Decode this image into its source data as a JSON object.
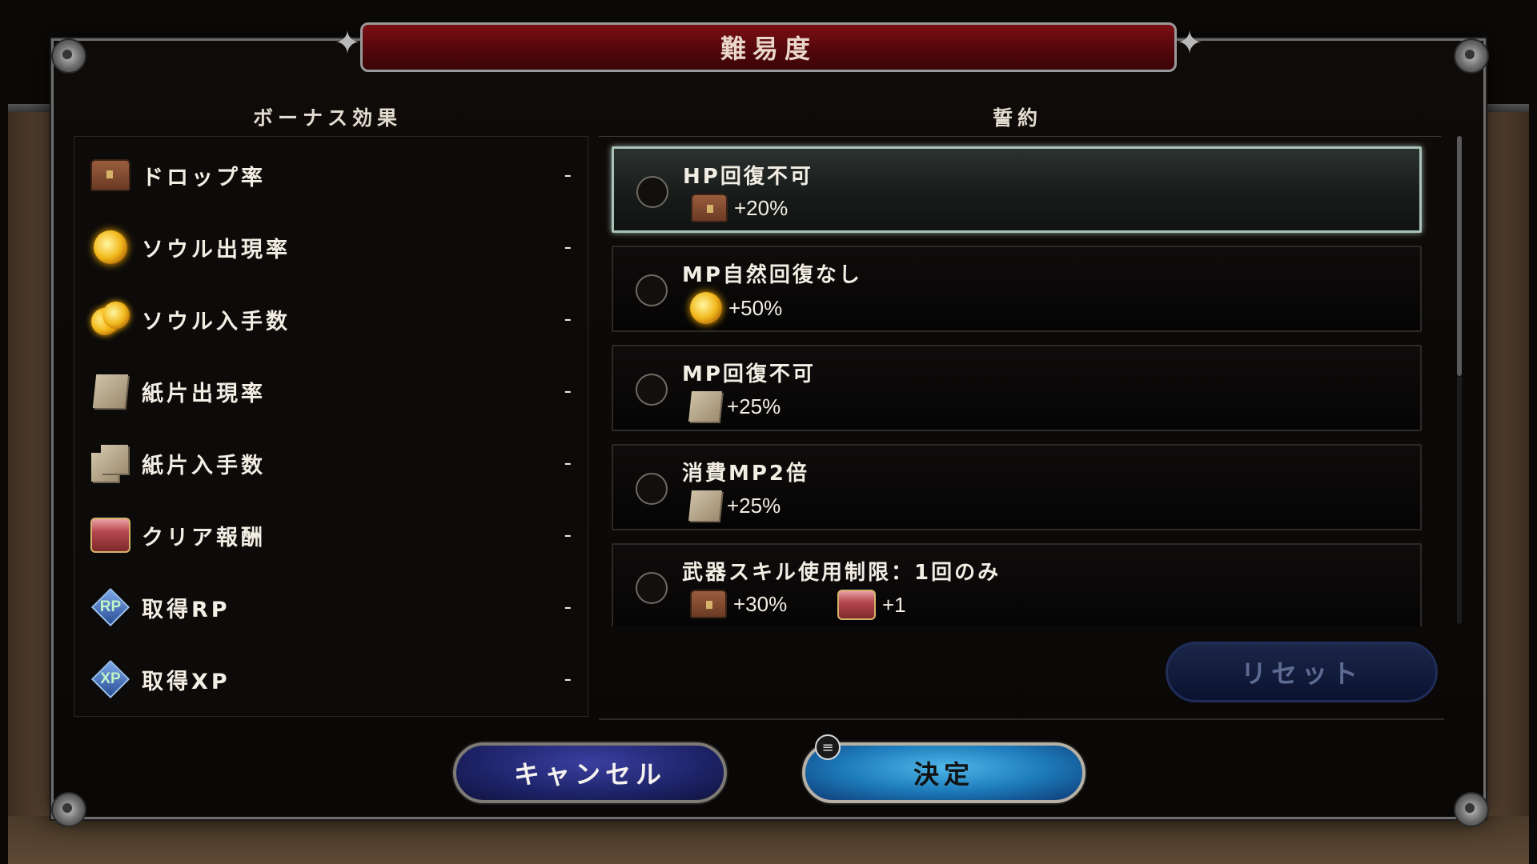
{
  "title": "難易度",
  "left_header": "ボーナス効果",
  "right_header": "誓約",
  "bonus_items": [
    {
      "icon": "treasure-chest-icon",
      "label": "ドロップ率",
      "value": "-"
    },
    {
      "icon": "soul-orb-icon",
      "label": "ソウル出現率",
      "value": "-"
    },
    {
      "icon": "soul-orbs-icon",
      "label": "ソウル入手数",
      "value": "-"
    },
    {
      "icon": "paper-scrap-icon",
      "label": "紙片出現率",
      "value": "-"
    },
    {
      "icon": "paper-scraps-icon",
      "label": "紙片入手数",
      "value": "-"
    },
    {
      "icon": "reward-chest-icon",
      "label": "クリア報酬",
      "value": "-"
    },
    {
      "icon": "rp-icon",
      "label": "取得RP",
      "value": "-"
    },
    {
      "icon": "xp-icon",
      "label": "取得XP",
      "value": "-"
    }
  ],
  "oaths": [
    {
      "title": "HP回復不可",
      "effects": [
        {
          "icon": "treasure-chest-icon",
          "value": "+20%"
        }
      ],
      "selected": true
    },
    {
      "title": "MP自然回復なし",
      "effects": [
        {
          "icon": "soul-orb-icon",
          "value": "+50%"
        }
      ],
      "selected": false
    },
    {
      "title": "MP回復不可",
      "effects": [
        {
          "icon": "paper-scrap-icon",
          "value": "+25%"
        }
      ],
      "selected": false
    },
    {
      "title": "消費MP2倍",
      "effects": [
        {
          "icon": "paper-scrap-icon",
          "value": "+25%"
        }
      ],
      "selected": false
    },
    {
      "title": "武器スキル使用制限：1回のみ",
      "effects": [
        {
          "icon": "treasure-chest-icon",
          "value": "+30%"
        },
        {
          "icon": "reward-chest-icon",
          "value": "+1"
        }
      ],
      "selected": false
    }
  ],
  "buttons": {
    "reset": "リセット",
    "cancel": "キャンセル",
    "confirm": "決定"
  },
  "menu_icon_glyph": "≡",
  "colors": {
    "banner": "#7b0f14",
    "selected_border": "#a9c3b8",
    "confirm_button": "#1e7dbc",
    "cancel_button": "#1e2368"
  }
}
